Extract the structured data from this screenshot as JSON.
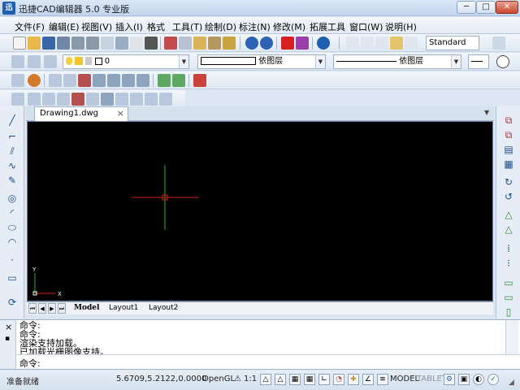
{
  "window": {
    "title": "迅捷CAD编辑器 5.0 专业版",
    "logo_text": "迅",
    "min_glyph": "─",
    "max_glyph": "□",
    "close_glyph": "✕"
  },
  "menu": {
    "items": [
      "文件(F)",
      "编辑(E)",
      "视图(V)",
      "插入(I)",
      "格式",
      "工具(T)",
      "绘制(D)",
      "标注(N)",
      "修改(M)",
      "拓展工具",
      "窗口(W)",
      "说明(H)"
    ]
  },
  "toolbar": {
    "text_style_value": "Standard",
    "layer_value": "0",
    "color_value": "依图层",
    "linetype_value": "依图层"
  },
  "document": {
    "tab_name": "Drawing1.dwg",
    "tab_close": "×",
    "dropdown": "▼"
  },
  "layouts": {
    "tabs": [
      "Model",
      "Layout1",
      "Layout2"
    ],
    "nav": [
      "⏮",
      "◀",
      "▶",
      "⏭"
    ]
  },
  "ucs": {
    "x_label": "X",
    "y_label": "Y"
  },
  "command": {
    "history": [
      "命令:",
      "命令:",
      "渲染支持加载。",
      "已加载光栅图像支持。"
    ],
    "prompt": "命令:",
    "ctrl_close": "×",
    "ctrl_pin": "▪"
  },
  "status": {
    "ready": "准备就绪",
    "coordinates": "5.6709,5.2122,0.0000",
    "renderer": "OpenGL",
    "scale": "1:1",
    "model": "MODEL",
    "tablet": "TABLET"
  },
  "colors": {
    "canvas_bg": "#000000",
    "crosshair_h": "#d81e1e",
    "crosshair_v": "#22b222",
    "accent": "#1d5fb0"
  }
}
